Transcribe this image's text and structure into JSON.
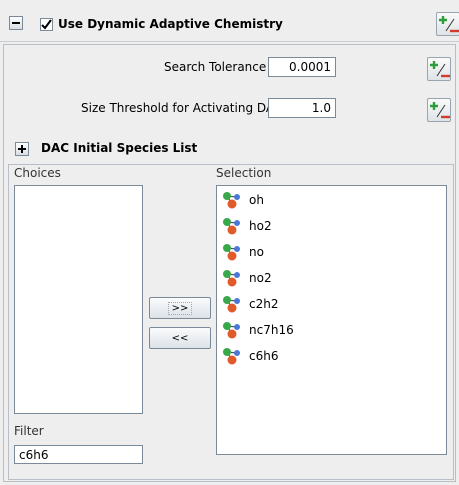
{
  "header": {
    "collapse_glyph": "−",
    "checkbox_checked": true,
    "title": "Use Dynamic Adaptive Chemistry"
  },
  "fields": [
    {
      "label": "Search Tolerance",
      "value": "0.0001"
    },
    {
      "label": "Size Threshold for Activating DAC",
      "value": "1.0"
    }
  ],
  "species_section": {
    "expand_glyph": "+",
    "title": "DAC Initial Species List"
  },
  "choices": {
    "label": "Choices",
    "items": []
  },
  "selection": {
    "label": "Selection",
    "items": [
      "oh",
      "ho2",
      "no",
      "no2",
      "c2h2",
      "nc7h16",
      "c6h6"
    ]
  },
  "buttons": {
    "add": ">>",
    "remove": "<<"
  },
  "filter": {
    "label": "Filter",
    "value": "c6h6"
  },
  "colors": {
    "accent_green": "#2e9e3a",
    "accent_red": "#d23a2a",
    "atom_red": "#e05a2a",
    "atom_green": "#3aa84a",
    "atom_blue": "#4a78d8"
  }
}
